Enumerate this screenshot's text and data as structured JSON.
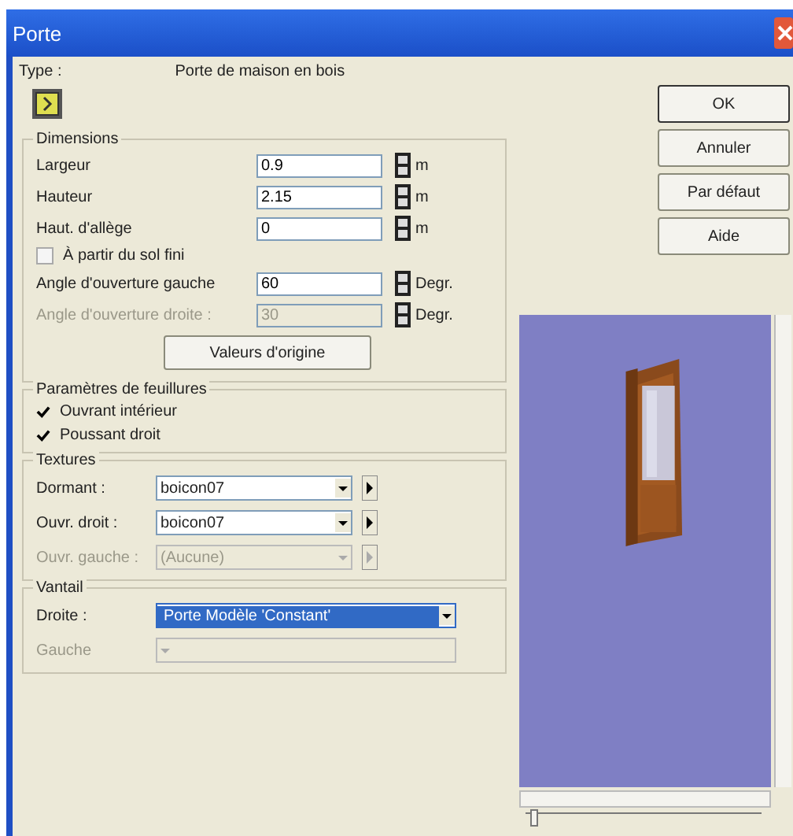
{
  "window": {
    "title": "Porte"
  },
  "type": {
    "label": "Type :",
    "value": "Porte de maison en bois"
  },
  "dimensions": {
    "title": "Dimensions",
    "fields": [
      {
        "label": "Largeur",
        "value": "0.9",
        "unit": "m",
        "disabled": false
      },
      {
        "label": "Hauteur",
        "value": "2.15",
        "unit": "m",
        "disabled": false
      },
      {
        "label": "Haut. d'allège",
        "value": "0",
        "unit": "m",
        "disabled": false
      }
    ],
    "floor_checkbox": {
      "label": "À partir du sol fini",
      "checked": false
    },
    "angles": [
      {
        "label": "Angle d'ouverture gauche",
        "value": "60",
        "unit": "Degr.",
        "disabled": false
      },
      {
        "label": "Angle d'ouverture droite :",
        "value": "30",
        "unit": "Degr.",
        "disabled": true
      }
    ],
    "reset_button": "Valeurs d'origine"
  },
  "rebates": {
    "title": "Paramètres de feuillures",
    "checkboxes": [
      {
        "label": "Ouvrant intérieur",
        "checked": true
      },
      {
        "label": "Poussant droit",
        "checked": true
      }
    ]
  },
  "textures": {
    "title": "Textures",
    "rows": [
      {
        "label": "Dormant :",
        "value": "boicon07",
        "disabled": false
      },
      {
        "label": "Ouvr. droit :",
        "value": "boicon07",
        "disabled": false
      },
      {
        "label": "Ouvr. gauche :",
        "value": "(Aucune)",
        "disabled": true
      }
    ]
  },
  "leaf": {
    "title": "Vantail",
    "rows": [
      {
        "label": "Droite :",
        "value": "Porte Modèle 'Constant'",
        "disabled": false,
        "selected": true
      },
      {
        "label": "Gauche",
        "disabled": true,
        "selected": false
      }
    ]
  },
  "buttons": [
    {
      "label": "OK",
      "default": true
    },
    {
      "label": "Annuler",
      "default": false
    },
    {
      "label": "Par défaut",
      "default": false
    },
    {
      "label": "Aide",
      "default": false
    }
  ],
  "preview": {
    "zoom": {
      "level": 0.02
    }
  }
}
